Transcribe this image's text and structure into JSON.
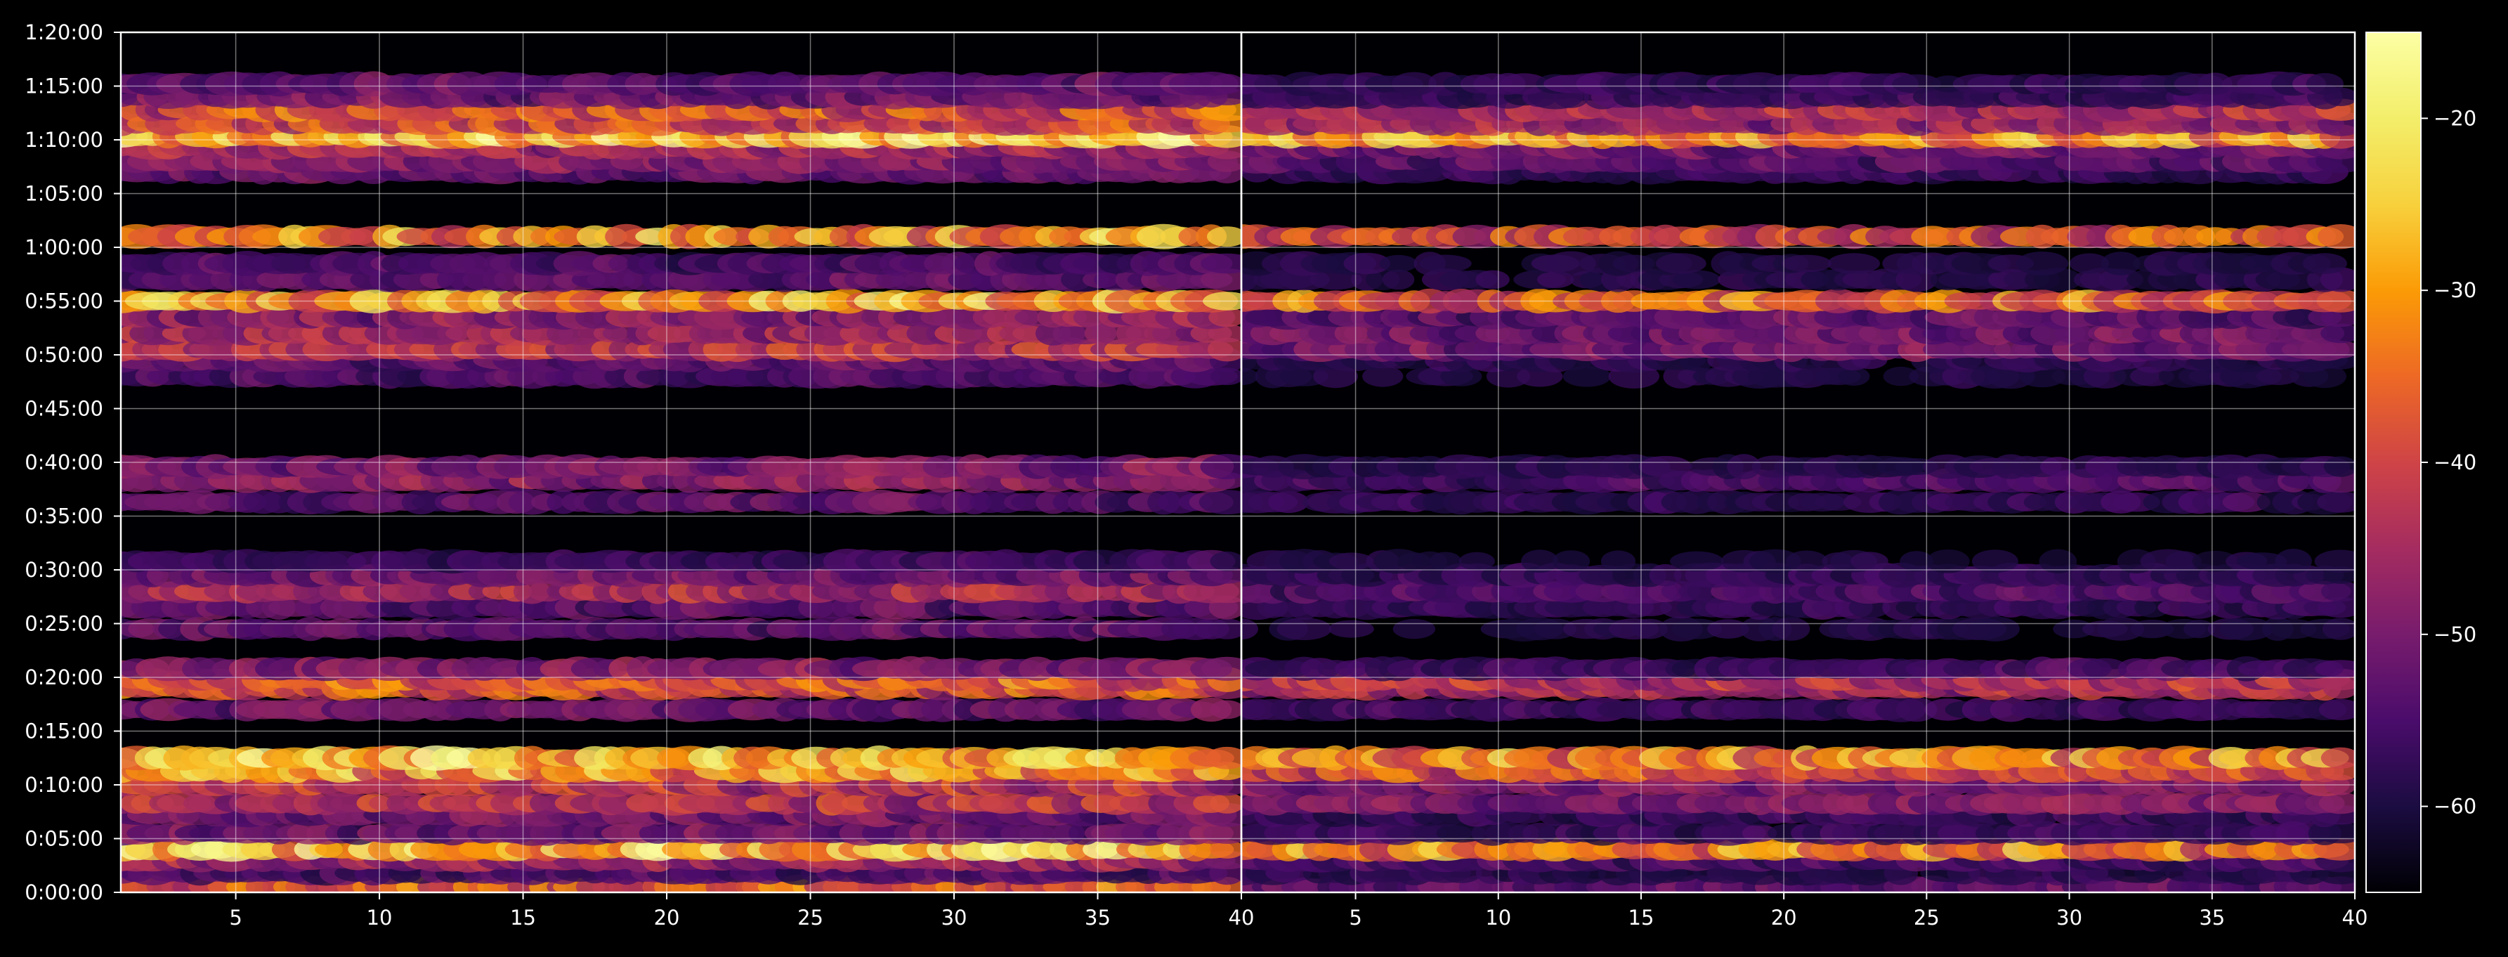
{
  "chart_data": {
    "type": "heatmap",
    "title": "",
    "xlabel": "",
    "ylabel": "",
    "panels": [
      {
        "name": "",
        "xlim": [
          1,
          40
        ],
        "xticks": [
          5,
          10,
          15,
          20,
          25,
          30,
          35,
          40
        ],
        "band_intensity": [
          [
            0.5,
            0.7
          ],
          [
            1.8,
            0.25
          ],
          [
            3.0,
            0.45
          ],
          [
            4.0,
            1.0
          ],
          [
            5.5,
            0.35
          ],
          [
            7.2,
            0.35
          ],
          [
            8.3,
            0.55
          ],
          [
            10.0,
            0.55
          ],
          [
            11.3,
            0.85
          ],
          [
            12.5,
            0.95
          ],
          [
            17.0,
            0.35
          ],
          [
            19.0,
            0.65
          ],
          [
            19.8,
            0.7
          ],
          [
            20.8,
            0.4
          ],
          [
            24.5,
            0.3
          ],
          [
            26.5,
            0.3
          ],
          [
            28.0,
            0.5
          ],
          [
            29.5,
            0.35
          ],
          [
            30.8,
            0.2
          ],
          [
            36.3,
            0.3
          ],
          [
            38.3,
            0.42
          ],
          [
            39.6,
            0.38
          ],
          [
            48.0,
            0.25
          ],
          [
            49.5,
            0.3
          ],
          [
            50.5,
            0.55
          ],
          [
            52.0,
            0.48
          ],
          [
            53.5,
            0.42
          ],
          [
            55.0,
            0.88
          ],
          [
            57.0,
            0.3
          ],
          [
            58.5,
            0.25
          ],
          [
            61.0,
            0.85
          ],
          [
            67.0,
            0.32
          ],
          [
            68.0,
            0.42
          ],
          [
            69.3,
            0.5
          ],
          [
            70.3,
            1.0
          ],
          [
            71.5,
            0.62
          ],
          [
            72.8,
            0.65
          ],
          [
            74.0,
            0.35
          ],
          [
            75.2,
            0.3
          ]
        ]
      },
      {
        "name": "",
        "xlim": [
          1,
          40
        ],
        "xticks": [
          5,
          10,
          15,
          20,
          25,
          30,
          35,
          40
        ],
        "band_intensity": [
          [
            0.5,
            0.3
          ],
          [
            1.8,
            0.15
          ],
          [
            3.0,
            0.25
          ],
          [
            4.0,
            0.8
          ],
          [
            5.5,
            0.2
          ],
          [
            7.2,
            0.2
          ],
          [
            8.3,
            0.38
          ],
          [
            10.0,
            0.38
          ],
          [
            11.3,
            0.65
          ],
          [
            12.5,
            0.8
          ],
          [
            17.0,
            0.2
          ],
          [
            19.0,
            0.5
          ],
          [
            19.8,
            0.55
          ],
          [
            20.8,
            0.22
          ],
          [
            24.5,
            0.12
          ],
          [
            26.5,
            0.18
          ],
          [
            28.0,
            0.25
          ],
          [
            29.5,
            0.18
          ],
          [
            30.8,
            0.1
          ],
          [
            36.3,
            0.18
          ],
          [
            38.3,
            0.25
          ],
          [
            39.6,
            0.15
          ],
          [
            48.0,
            0.12
          ],
          [
            49.5,
            0.15
          ],
          [
            50.5,
            0.35
          ],
          [
            52.0,
            0.35
          ],
          [
            53.5,
            0.3
          ],
          [
            55.0,
            0.72
          ],
          [
            57.0,
            0.15
          ],
          [
            58.5,
            0.12
          ],
          [
            61.0,
            0.65
          ],
          [
            67.0,
            0.18
          ],
          [
            68.0,
            0.28
          ],
          [
            69.3,
            0.35
          ],
          [
            70.3,
            0.85
          ],
          [
            71.5,
            0.45
          ],
          [
            72.8,
            0.5
          ],
          [
            74.0,
            0.2
          ],
          [
            75.2,
            0.18
          ]
        ]
      }
    ],
    "ylim": [
      0,
      80
    ],
    "y_units": "minutes",
    "yticks": [
      "0:00:00",
      "0:05:00",
      "0:10:00",
      "0:15:00",
      "0:20:00",
      "0:25:00",
      "0:30:00",
      "0:35:00",
      "0:40:00",
      "0:45:00",
      "0:50:00",
      "0:55:00",
      "1:00:00",
      "1:05:00",
      "1:10:00",
      "1:15:00",
      "1:20:00"
    ],
    "colorbar": {
      "colormap": "inferno",
      "range": [
        -65,
        -15
      ],
      "ticks": [
        -20,
        -30,
        -40,
        -50,
        -60
      ],
      "tick_labels": [
        "−20",
        "−30",
        "−40",
        "−50",
        "−60"
      ]
    },
    "grid": true,
    "legend": "none"
  }
}
